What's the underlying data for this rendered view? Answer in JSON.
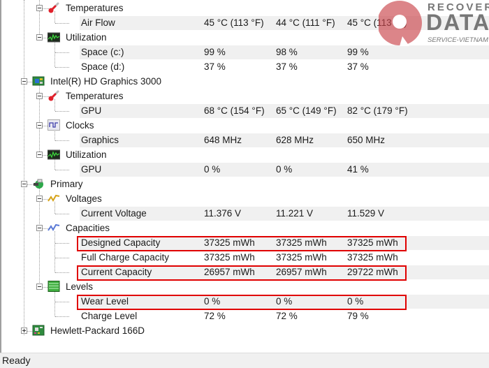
{
  "tree": {
    "columns_hidden": true,
    "rows": [
      {
        "label": "Temperatures",
        "type": "group",
        "icon": "thermometer-icon"
      },
      {
        "label": "Air Flow",
        "type": "leaf",
        "values": [
          "45 °C  (113 °F)",
          "44 °C  (111 °F)",
          "45 °C  (113 °F)"
        ]
      },
      {
        "label": "Utilization",
        "type": "group",
        "icon": "utilization-graph-icon"
      },
      {
        "label": "Space (c:)",
        "type": "leaf",
        "values": [
          "99 %",
          "98 %",
          "99 %"
        ]
      },
      {
        "label": "Space (d:)",
        "type": "leaf",
        "values": [
          "37 %",
          "37 %",
          "37 %"
        ]
      },
      {
        "label": "Intel(R) HD Graphics 3000",
        "type": "device",
        "icon": "graphics-card-icon"
      },
      {
        "label": "Temperatures",
        "type": "group",
        "icon": "thermometer-icon"
      },
      {
        "label": "GPU",
        "type": "leaf",
        "values": [
          "68 °C  (154 °F)",
          "65 °C  (149 °F)",
          "82 °C  (179 °F)"
        ]
      },
      {
        "label": "Clocks",
        "type": "group",
        "icon": "clock-wave-icon"
      },
      {
        "label": "Graphics",
        "type": "leaf",
        "values": [
          "648 MHz",
          "628 MHz",
          "650 MHz"
        ]
      },
      {
        "label": "Utilization",
        "type": "group",
        "icon": "utilization-graph-icon"
      },
      {
        "label": "GPU",
        "type": "leaf",
        "values": [
          "0 %",
          "0 %",
          "41 %"
        ]
      },
      {
        "label": "Primary",
        "type": "device",
        "icon": "battery-plug-icon"
      },
      {
        "label": "Voltages",
        "type": "group",
        "icon": "voltage-icon"
      },
      {
        "label": "Current Voltage",
        "type": "leaf",
        "values": [
          "11.376 V",
          "11.221 V",
          "11.529 V"
        ]
      },
      {
        "label": "Capacities",
        "type": "group",
        "icon": "capacity-icon"
      },
      {
        "label": "Designed Capacity",
        "type": "leaf",
        "values": [
          "37325 mWh",
          "37325 mWh",
          "37325 mWh"
        ],
        "highlighted": true
      },
      {
        "label": "Full Charge Capacity",
        "type": "leaf",
        "values": [
          "37325 mWh",
          "37325 mWh",
          "37325 mWh"
        ]
      },
      {
        "label": "Current Capacity",
        "type": "leaf",
        "values": [
          "26957 mWh",
          "26957 mWh",
          "29722 mWh"
        ],
        "highlighted": true
      },
      {
        "label": "Levels",
        "type": "group",
        "icon": "levels-icon"
      },
      {
        "label": "Wear Level",
        "type": "leaf",
        "values": [
          "0 %",
          "0 %",
          "0 %"
        ],
        "highlighted": true
      },
      {
        "label": "Charge Level",
        "type": "leaf",
        "values": [
          "72 %",
          "72 %",
          "79 %"
        ]
      },
      {
        "label": "Hewlett-Packard 166D",
        "type": "device",
        "icon": "motherboard-icon",
        "collapsed": true
      }
    ]
  },
  "status": {
    "text": "Ready"
  },
  "watermark": {
    "line1": "RECOVER",
    "line2": "DATA",
    "line3": "SERVICE-VIETNAM"
  },
  "colors": {
    "highlight_border": "#e00000",
    "stripe": "#f0f0f0"
  }
}
